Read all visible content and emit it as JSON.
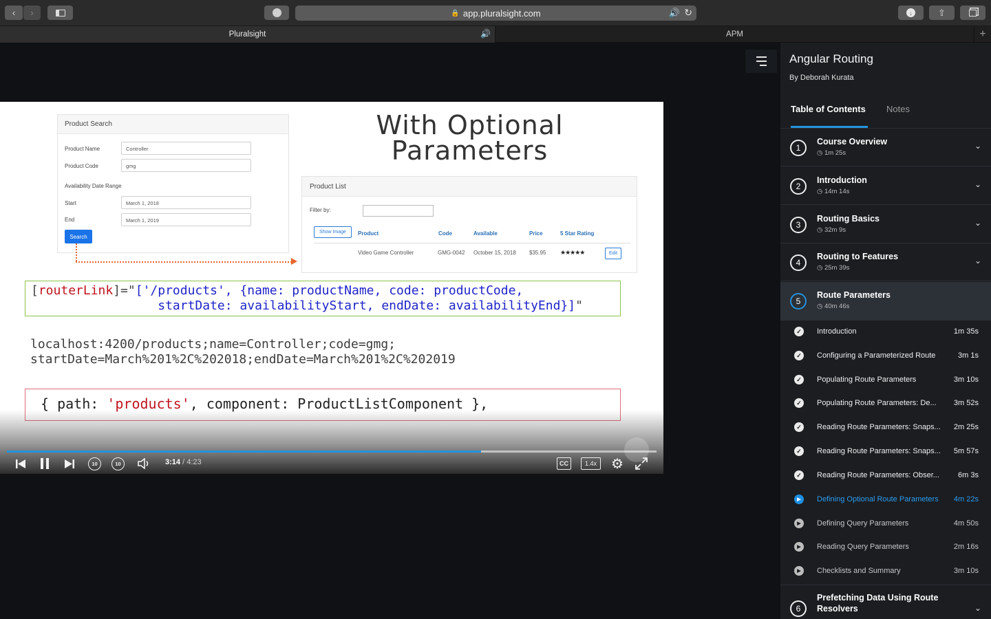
{
  "browser": {
    "url": "app.pluralsight.com",
    "tabs": [
      {
        "label": "Pluralsight"
      },
      {
        "label": "APM"
      }
    ]
  },
  "slide": {
    "title_line1": "With Optional",
    "title_line2": "Parameters",
    "product_search": {
      "heading": "Product Search",
      "name_label": "Product Name",
      "name_value": "Controller",
      "code_label": "Product Code",
      "code_value": "gmg",
      "range_label": "Availability Date Range",
      "start_label": "Start",
      "start_value": "March 1, 2018",
      "end_label": "End",
      "end_value": "March 1, 2019",
      "search_button": "Search"
    },
    "product_list": {
      "heading": "Product List",
      "filter_label": "Filter by:",
      "show_image_button": "Show Image",
      "columns": [
        "Product",
        "Code",
        "Available",
        "Price",
        "5 Star Rating"
      ],
      "row": {
        "product": "Video Game Controller",
        "code": "GMG-0042",
        "available": "October 15, 2018",
        "price": "$35.95",
        "rating": "★★★★★"
      },
      "edit_button": "Edit"
    },
    "code1": {
      "p1": "[",
      "p2": "routerLink",
      "p3": "]=\"",
      "p4": "['/products', {name: productName, code: productCode,",
      "p5": "                 startDate: availabilityStart, endDate: availabilityEnd}]",
      "p6": "\""
    },
    "url_line1": "localhost:4200/products;name=Controller;code=gmg;",
    "url_line2": "startDate=March%201%2C%202018;endDate=March%201%2C%202019",
    "code2": {
      "p1": "{ path: ",
      "p2": "'products'",
      "p3": ", component: ProductListComponent },"
    }
  },
  "player": {
    "time_current": "3:14",
    "time_total": "/ 4:23",
    "progress": 0.73,
    "skip_back_label": "10",
    "skip_forward_label": "10",
    "cc_label": "CC",
    "speed_label": "1.4x"
  },
  "sidebar": {
    "course_title": "Angular Routing",
    "author": "By Deborah Kurata",
    "tabs": {
      "toc": "Table of Contents",
      "notes": "Notes"
    },
    "modules": [
      {
        "num": "1",
        "title": "Course Overview",
        "duration": "1m 25s"
      },
      {
        "num": "2",
        "title": "Introduction",
        "duration": "14m 14s"
      },
      {
        "num": "3",
        "title": "Routing Basics",
        "duration": "32m 9s"
      },
      {
        "num": "4",
        "title": "Routing to Features",
        "duration": "25m 39s"
      },
      {
        "num": "5",
        "title": "Route Parameters",
        "duration": "40m 46s"
      },
      {
        "num": "6",
        "title": "Prefetching Data Using Route",
        "title2": "Resolvers"
      }
    ],
    "clips": [
      {
        "title": "Introduction",
        "duration": "1m 35s",
        "state": "done"
      },
      {
        "title": "Configuring a Parameterized Route",
        "duration": "3m 1s",
        "state": "done"
      },
      {
        "title": "Populating Route Parameters",
        "duration": "3m 10s",
        "state": "done"
      },
      {
        "title": "Populating Route Parameters: De...",
        "duration": "3m 52s",
        "state": "done"
      },
      {
        "title": "Reading Route Parameters: Snaps...",
        "duration": "2m 25s",
        "state": "done"
      },
      {
        "title": "Reading Route Parameters: Snaps...",
        "duration": "5m 57s",
        "state": "done"
      },
      {
        "title": "Reading Route Parameters: Obser...",
        "duration": "6m 3s",
        "state": "done"
      },
      {
        "title": "Defining Optional Route Parameters",
        "duration": "4m 22s",
        "state": "current"
      },
      {
        "title": "Defining Query Parameters",
        "duration": "4m 50s",
        "state": "upcoming"
      },
      {
        "title": "Reading Query Parameters",
        "duration": "2m 16s",
        "state": "upcoming"
      },
      {
        "title": "Checklists and Summary",
        "duration": "3m 10s",
        "state": "upcoming"
      }
    ]
  },
  "colors": {
    "accent": "#2493dc",
    "current_clip": "#2b9cf0"
  }
}
